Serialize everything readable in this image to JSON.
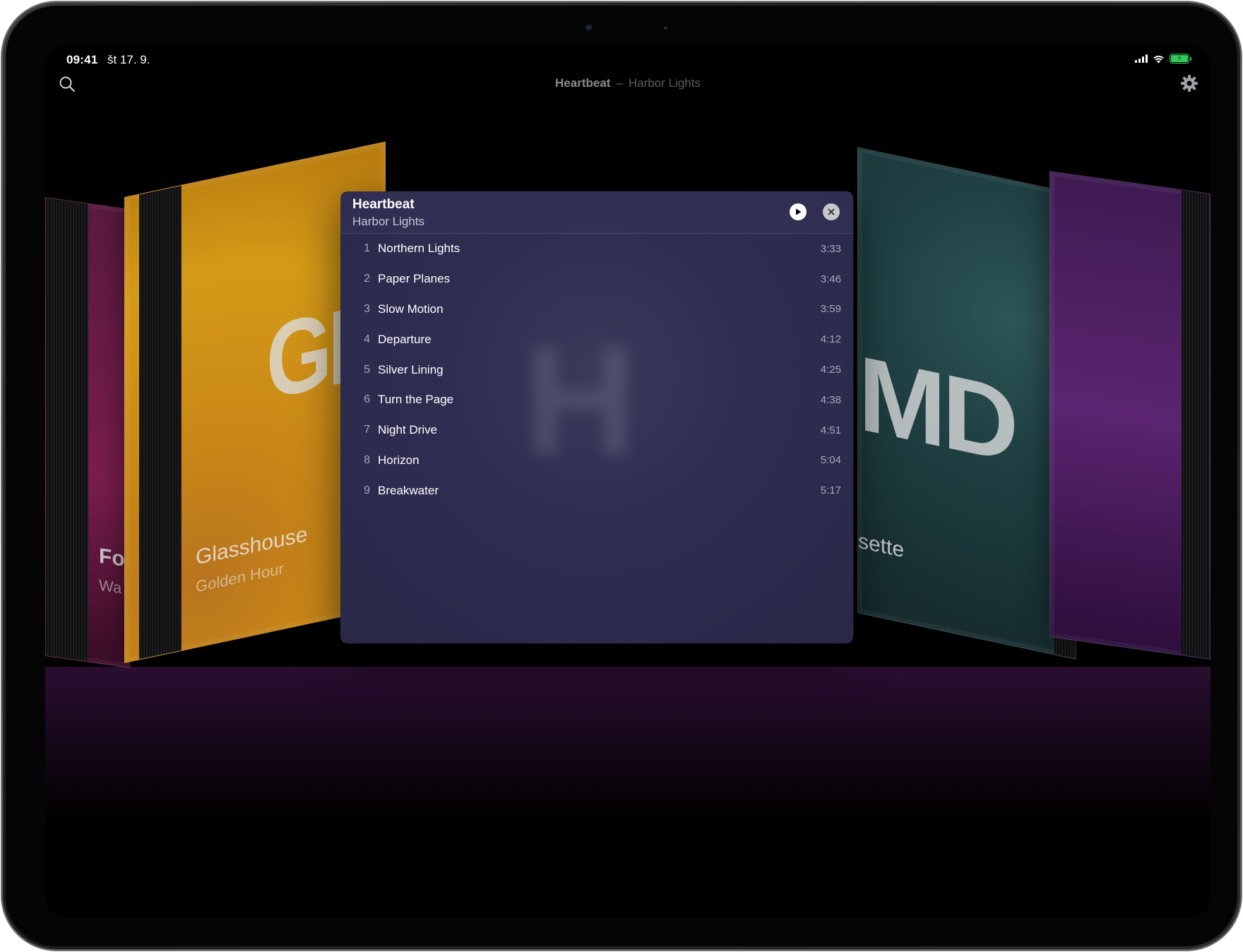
{
  "status_bar": {
    "time": "09:41",
    "date": "št 17. 9."
  },
  "header": {
    "now_playing_title": "Heartbeat",
    "separator": "–",
    "now_playing_artist": "Harbor Lights"
  },
  "coverflow": {
    "left_album": {
      "cover_text": "GH",
      "title": "Glasshouse",
      "artist": "Golden Hour"
    },
    "far_left_album": {
      "title_fragment": "Fo",
      "artist_fragment": "Wa"
    },
    "right_album": {
      "cover_text": "MD",
      "title_fragment": "sette"
    }
  },
  "panel": {
    "title": "Heartbeat",
    "artist": "Harbor Lights",
    "tracks": [
      {
        "num": "1",
        "title": "Northern Lights",
        "duration": "3:33"
      },
      {
        "num": "2",
        "title": "Paper Planes",
        "duration": "3:46"
      },
      {
        "num": "3",
        "title": "Slow Motion",
        "duration": "3:59"
      },
      {
        "num": "4",
        "title": "Departure",
        "duration": "4:12"
      },
      {
        "num": "5",
        "title": "Silver Lining",
        "duration": "4:25"
      },
      {
        "num": "6",
        "title": "Turn the Page",
        "duration": "4:38"
      },
      {
        "num": "7",
        "title": "Night Drive",
        "duration": "4:51"
      },
      {
        "num": "8",
        "title": "Horizon",
        "duration": "5:04"
      },
      {
        "num": "9",
        "title": "Breakwater",
        "duration": "5:17"
      }
    ]
  },
  "icons": {
    "search": "search-icon",
    "settings": "gear-icon",
    "play": "play-icon",
    "close": "close-icon",
    "signal": "signal-icon",
    "wifi": "wifi-icon",
    "battery": "battery-charging-icon"
  },
  "colors": {
    "battery": "#34c759",
    "panel_bg": "#2e2e52"
  }
}
